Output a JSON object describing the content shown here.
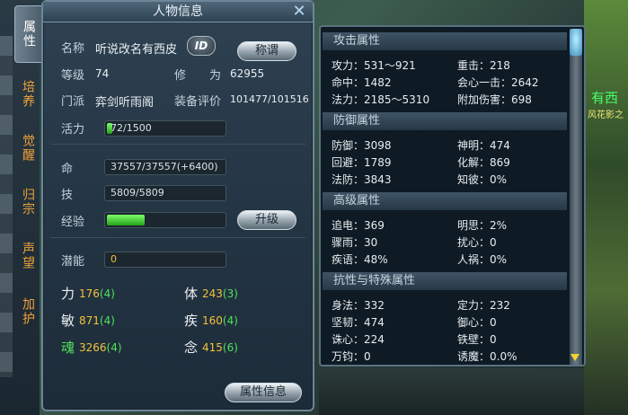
{
  "tabs": [
    {
      "label": "属性",
      "active": true
    },
    {
      "label": "培养",
      "active": false
    },
    {
      "label": "觉醒",
      "active": false
    },
    {
      "label": "归宗",
      "active": false
    },
    {
      "label": "声望",
      "active": false
    },
    {
      "label": "加护",
      "active": false
    }
  ],
  "char_panel": {
    "title": "人物信息",
    "name_label": "名称",
    "name_value": "听说改名有西皮",
    "id_badge": "ID",
    "title_button": "称谓",
    "level_label": "等级",
    "level_value": "74",
    "cultivation_label": "修　　为",
    "cultivation_value": "62955",
    "sect_label": "门派",
    "sect_value": "弈剑听雨阁",
    "gear_label": "装备评价",
    "gear_value": "101477/101516",
    "vigor_label": "活力",
    "vigor_value": "72/1500",
    "vigor_fraction": 0.048,
    "hp_label": "命",
    "hp_value": "37557/37557(+6400)",
    "mp_label": "技",
    "mp_value": "5809/5809",
    "exp_label": "经验",
    "exp_fraction": 0.32,
    "upgrade_button": "升级",
    "potential_label": "潜能",
    "potential_value": "0",
    "attributes": [
      {
        "label": "力",
        "value": "176",
        "bonus": "(4)"
      },
      {
        "label": "体",
        "value": "243",
        "bonus": "(3)"
      },
      {
        "label": "敏",
        "value": "871",
        "bonus": "(4)"
      },
      {
        "label": "疾",
        "value": "160",
        "bonus": "(4)"
      },
      {
        "label": "魂",
        "value": "3266",
        "bonus": "(4)"
      },
      {
        "label": "念",
        "value": "415",
        "bonus": "(6)"
      }
    ],
    "details_button": "属性信息"
  },
  "detail_panel": {
    "sections": [
      {
        "title": "攻击属性"
      },
      {
        "title": "防御属性"
      },
      {
        "title": "高级属性"
      },
      {
        "title": "抗性与特殊属性"
      }
    ],
    "rows": [
      [
        "攻力：531～921",
        "重击：218"
      ],
      [
        "命中：1482",
        "会心一击：2642"
      ],
      [
        "法力：2185～5310",
        "附加伤害：698"
      ],
      [
        "防御：3098",
        "神明：474"
      ],
      [
        "回避：1789",
        "化解：869"
      ],
      [
        "法防：3843",
        "知彼：0%"
      ],
      [
        "追电：369",
        "明思：2%"
      ],
      [
        "骤雨：30",
        "扰心：0"
      ],
      [
        "疾语：48%",
        "人祸：0%"
      ],
      [
        "身法：332",
        "定力：232"
      ],
      [
        "坚韧：474",
        "御心：0"
      ],
      [
        "诛心：224",
        "铁壁：0"
      ],
      [
        "万钧：0",
        "诱魔：0.0%"
      ]
    ]
  },
  "scene": {
    "npc_name": "有西",
    "npc_sub": "风花影之"
  },
  "colors": {
    "attr_value": "#f2c23a",
    "attr_bonus": "#4fe25a",
    "soul_label": "#4fe25a",
    "tab_inactive": "#f0a23a",
    "exp_bar": "#3ecf2c"
  }
}
